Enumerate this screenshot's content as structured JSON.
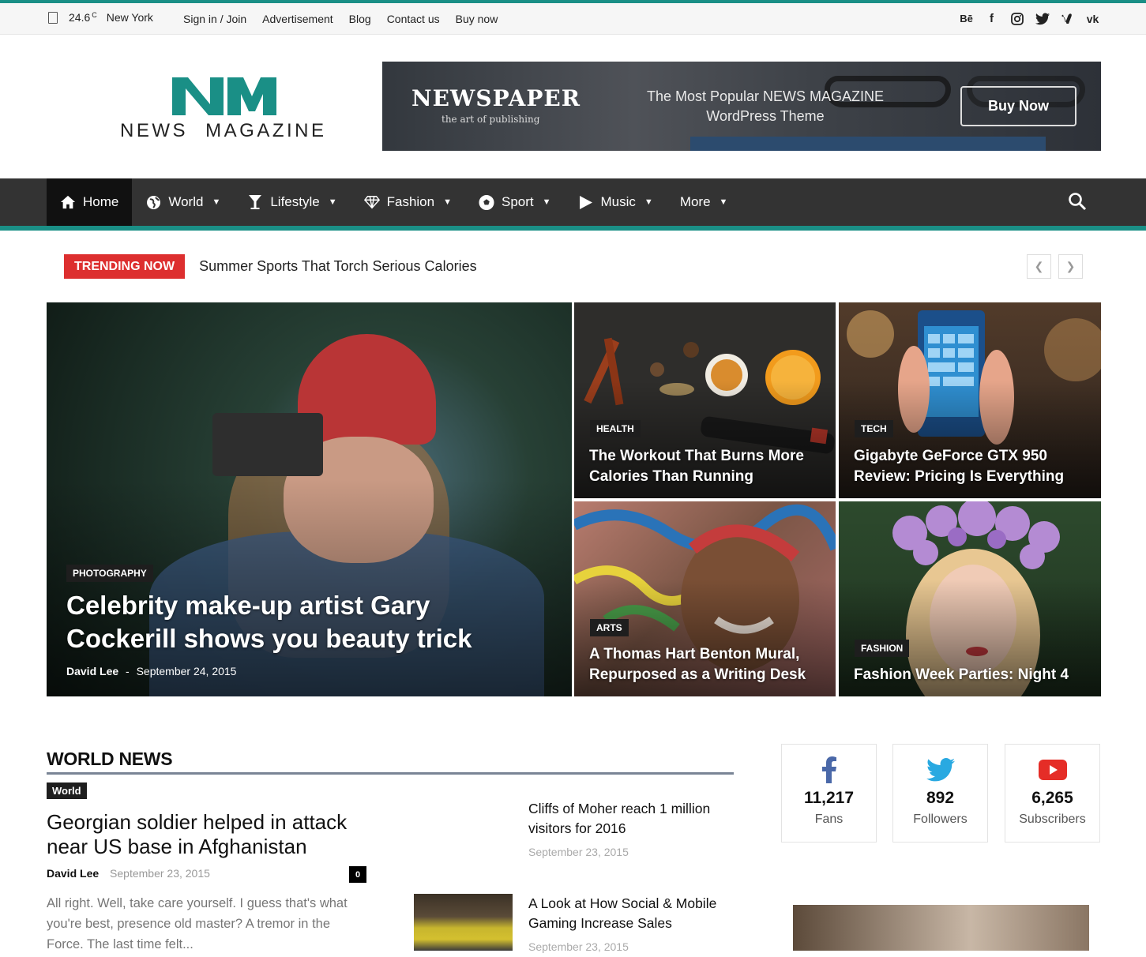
{
  "topbar": {
    "temperature": "24.6",
    "unit": "C",
    "city": "New York",
    "links": [
      "Sign in / Join",
      "Advertisement",
      "Blog",
      "Contact us",
      "Buy now"
    ],
    "social_icons": [
      "behance-icon",
      "facebook-icon",
      "instagram-icon",
      "twitter-icon",
      "vimeo-icon",
      "vk-icon"
    ],
    "behance_label": "Bē",
    "facebook_label": "f"
  },
  "logo": {
    "mark": "NM",
    "text": "NEWS MAGAZINE"
  },
  "ad": {
    "brand": "NEWSPAPER",
    "subtitle": "the art of publishing",
    "tagline_1": "The Most Popular NEWS MAGAZINE",
    "tagline_2": "WordPress Theme",
    "button": "Buy Now"
  },
  "nav": {
    "items": [
      {
        "label": "Home",
        "icon": "home-icon"
      },
      {
        "label": "World",
        "icon": "globe-icon"
      },
      {
        "label": "Lifestyle",
        "icon": "cocktail-icon"
      },
      {
        "label": "Fashion",
        "icon": "diamond-icon"
      },
      {
        "label": "Sport",
        "icon": "soccer-ball-icon"
      },
      {
        "label": "Music",
        "icon": "play-icon"
      },
      {
        "label": "More",
        "icon": ""
      }
    ]
  },
  "trending": {
    "badge": "TRENDING NOW",
    "headline": "Summer Sports That Torch Serious Calories"
  },
  "featured": {
    "main": {
      "category": "PHOTOGRAPHY",
      "title": "Celebrity make-up artist Gary Cockerill shows you beauty trick",
      "author": "David Lee",
      "separator": "-",
      "date": "September 24, 2015"
    },
    "tiles": [
      {
        "category": "HEALTH",
        "title": "The Workout That Burns More Calories Than Running"
      },
      {
        "category": "TECH",
        "title": "Gigabyte GeForce GTX 950 Review: Pricing Is Everything"
      },
      {
        "category": "ARTS",
        "title": "A Thomas Hart Benton Mural, Repurposed as a Writing Desk"
      },
      {
        "category": "FASHION",
        "title": "Fashion Week Parties: Night 4"
      }
    ]
  },
  "world_news": {
    "heading": "WORLD NEWS",
    "lead": {
      "category": "World",
      "title": "Georgian soldier helped in attack near US base in Afghanistan",
      "author": "David Lee",
      "date": "September 23, 2015",
      "comments": "0",
      "excerpt": "All right. Well, take care yourself. I guess that's what you're best, presence old master? A tremor in the Force. The last time felt..."
    },
    "side": [
      {
        "title": "Cliffs of Moher reach 1 million visitors for 2016",
        "date": "September 23, 2015"
      },
      {
        "title": "A Look at How Social & Mobile Gaming Increase Sales",
        "date": "September 23, 2015"
      }
    ]
  },
  "social_counters": [
    {
      "count": "11,217",
      "label": "Fans",
      "icon": "facebook-icon",
      "color": "#4a68a8"
    },
    {
      "count": "892",
      "label": "Followers",
      "icon": "twitter-icon",
      "color": "#29a9e1"
    },
    {
      "count": "6,265",
      "label": "Subscribers",
      "icon": "youtube-icon",
      "color": "#e52d27"
    }
  ],
  "colors": {
    "accent": "#1a8f86",
    "trending": "#dd2f2f",
    "nav_bg": "#333333"
  }
}
